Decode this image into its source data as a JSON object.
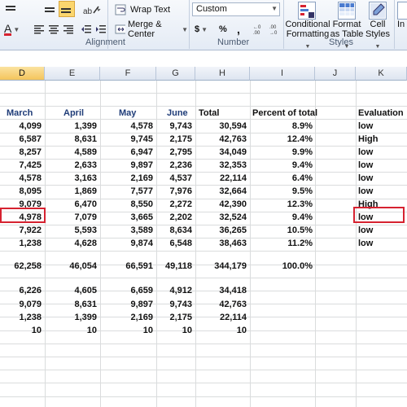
{
  "ribbon": {
    "wrap_text": "Wrap Text",
    "merge_center": "Merge & Center",
    "number_format": "Custom",
    "currency_symbol": "$",
    "percent_symbol": "%",
    "comma_symbol": ",",
    "conditional_formatting": [
      "Conditional",
      "Formatting"
    ],
    "format_as_table": [
      "Format",
      "as Table"
    ],
    "cell_styles": [
      "Cell",
      "Styles"
    ],
    "insert_partial": "In",
    "groups": {
      "alignment": "Alignment",
      "number": "Number",
      "styles": "Styles"
    }
  },
  "columns": [
    "D",
    "E",
    "F",
    "G",
    "H",
    "I",
    "J",
    "K"
  ],
  "headers": {
    "march": "March",
    "april": "April",
    "may": "May",
    "june": "June",
    "total": "Total",
    "percent": "Percent of total",
    "evaluation": "Evaluation"
  },
  "rows": [
    {
      "march": "4,099",
      "april": "1,399",
      "may": "4,578",
      "june": "9,743",
      "total": "30,594",
      "percent": "8.9%",
      "evaluation": "low"
    },
    {
      "march": "6,587",
      "april": "8,631",
      "may": "9,745",
      "june": "2,175",
      "total": "42,763",
      "percent": "12.4%",
      "evaluation": "High"
    },
    {
      "march": "8,257",
      "april": "4,589",
      "may": "6,947",
      "june": "2,795",
      "total": "34,049",
      "percent": "9.9%",
      "evaluation": "low"
    },
    {
      "march": "7,425",
      "april": "2,633",
      "may": "9,897",
      "june": "2,236",
      "total": "32,353",
      "percent": "9.4%",
      "evaluation": "low"
    },
    {
      "march": "4,578",
      "april": "3,163",
      "may": "2,169",
      "june": "4,537",
      "total": "22,114",
      "percent": "6.4%",
      "evaluation": "low"
    },
    {
      "march": "8,095",
      "april": "1,869",
      "may": "7,577",
      "june": "7,976",
      "total": "32,664",
      "percent": "9.5%",
      "evaluation": "low"
    },
    {
      "march": "9,079",
      "april": "6,470",
      "may": "8,550",
      "june": "2,272",
      "total": "42,390",
      "percent": "12.3%",
      "evaluation": "High"
    },
    {
      "march": "4,978",
      "april": "7,079",
      "may": "3,665",
      "june": "2,202",
      "total": "32,524",
      "percent": "9.4%",
      "evaluation": "low"
    },
    {
      "march": "7,922",
      "april": "5,593",
      "may": "3,589",
      "june": "8,634",
      "total": "36,265",
      "percent": "10.5%",
      "evaluation": "low"
    },
    {
      "march": "1,238",
      "april": "4,628",
      "may": "9,874",
      "june": "6,548",
      "total": "38,463",
      "percent": "11.2%",
      "evaluation": "low"
    }
  ],
  "totals": {
    "march": "62,258",
    "april": "46,054",
    "may": "66,591",
    "june": "49,118",
    "total": "344,179",
    "percent": "100.0%"
  },
  "stats": [
    {
      "march": "6,226",
      "april": "4,605",
      "may": "6,659",
      "june": "4,912",
      "total": "34,418"
    },
    {
      "march": "9,079",
      "april": "8,631",
      "may": "9,897",
      "june": "9,743",
      "total": "42,763"
    },
    {
      "march": "1,238",
      "april": "1,399",
      "may": "2,169",
      "june": "2,175",
      "total": "22,114"
    },
    {
      "march": "10",
      "april": "10",
      "may": "10",
      "june": "10",
      "total": "10"
    }
  ],
  "colors": {
    "header_blue": "#1f3c78",
    "highlight_red": "#d62230",
    "active_col": "#f4c45c"
  }
}
